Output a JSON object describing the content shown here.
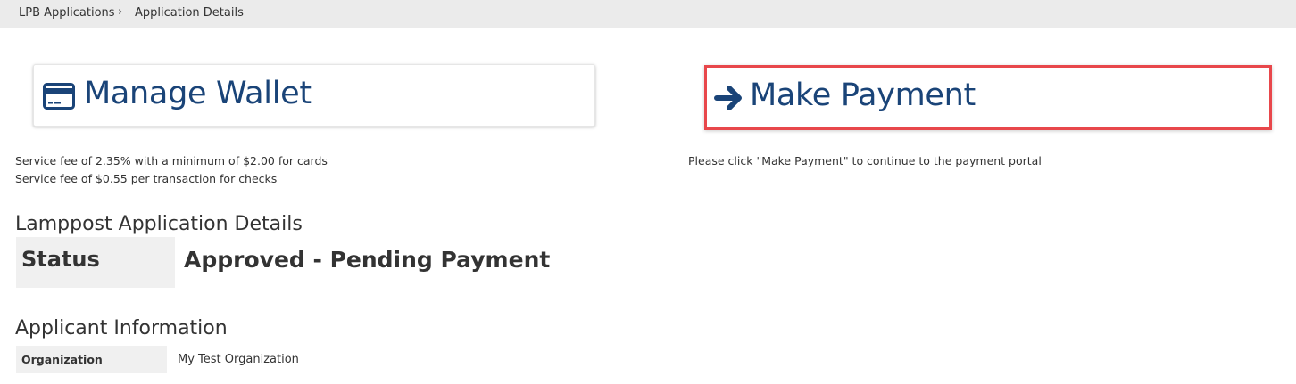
{
  "breadcrumb": {
    "items": [
      {
        "label": "LPB Applications"
      },
      {
        "label": "Application Details"
      }
    ],
    "separator": "›"
  },
  "wallet_card": {
    "label": "Manage Wallet",
    "icon": "credit-card-icon"
  },
  "payment_card": {
    "label": "Make Payment",
    "icon": "arrow-right-icon",
    "highlight_color": "#e8474b"
  },
  "fee_notes": {
    "cards": "Service fee of 2.35% with a minimum of $2.00 for cards",
    "checks": "Service fee of $0.55 per transaction for checks"
  },
  "payment_note": "Please click \"Make Payment\" to continue to the payment portal",
  "details": {
    "heading": "Lamppost Application Details",
    "status_label": "Status",
    "status_value": "Approved - Pending Payment"
  },
  "applicant": {
    "heading": "Applicant Information",
    "organization_label": "Organization",
    "organization_value": "My Test Organization"
  },
  "colors": {
    "accent": "#1a4478",
    "breadcrumb_bg": "#ebebeb",
    "label_cell_bg": "#f0f0f0"
  }
}
